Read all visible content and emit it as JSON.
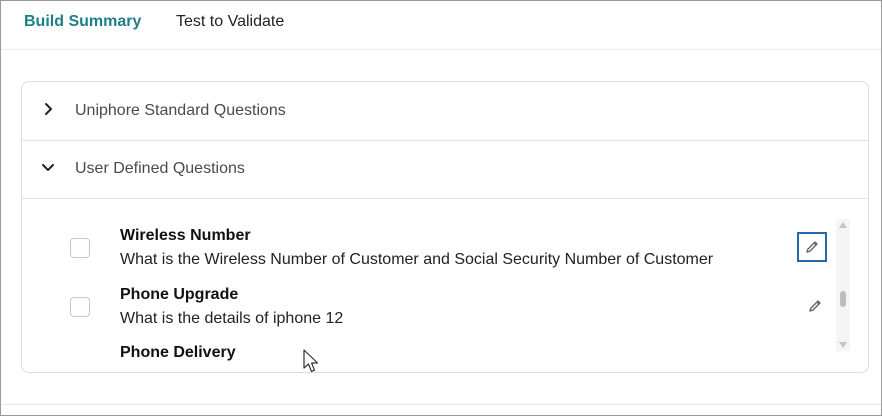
{
  "tabs": [
    {
      "label": "Build Summary",
      "active": true
    },
    {
      "label": "Test to Validate",
      "active": false
    }
  ],
  "accordions": [
    {
      "title": "Uniphore Standard Questions",
      "expanded": false,
      "icon": "chevron-right-icon"
    },
    {
      "title": "User Defined Questions",
      "expanded": true,
      "icon": "chevron-down-icon"
    }
  ],
  "questions": [
    {
      "name": "Wireless Number",
      "text": "What is the Wireless Number of Customer and Social Security Number of Customer",
      "edit_icon": "pencil-icon"
    },
    {
      "name": "Phone Upgrade",
      "text": "What is the details of iphone 12",
      "edit_icon": "pencil-icon"
    },
    {
      "name": "Phone Delivery",
      "text": "",
      "edit_icon": "pencil-icon"
    }
  ],
  "colors": {
    "accent": "#1f7f87",
    "focus_border": "#2569a8",
    "border": "#dddddd"
  }
}
